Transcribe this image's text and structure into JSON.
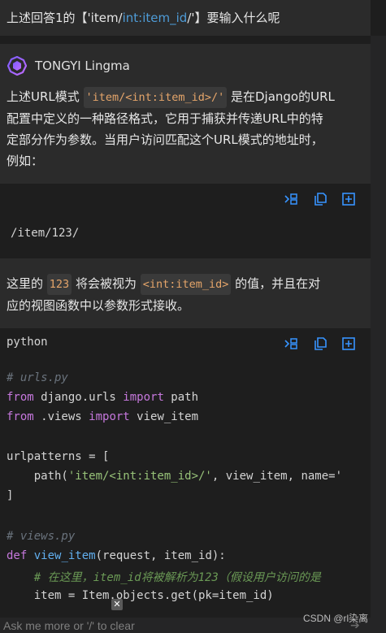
{
  "user_message": {
    "prefix": "上述回答1的【'item/",
    "highlight": "int:item_id",
    "suffix": "/'】要输入什么呢"
  },
  "assistant": {
    "name": "TONGYI Lingma",
    "para1": {
      "line1_pre": "上述URL模式 ",
      "line1_code": "'item/<int:item_id>/'",
      "line1_post": " 是在Django的URL",
      "line2": "配置中定义的一种路径格式，它用于捕获并传递URL中的特",
      "line3": "定部分作为参数。当用户访问匹配这个URL模式的地址时，",
      "line4": "例如："
    },
    "example_path": "/item/123/",
    "para2": {
      "l1_pre": "这里的 ",
      "l1_code1": "123",
      "l1_mid": " 将会被视为 ",
      "l1_code2": "<int:item_id>",
      "l1_post": " 的值，并且在对",
      "line2": "应的视图函数中以参数形式接收。"
    },
    "code_block": {
      "language": "python",
      "lines": {
        "c1": "# urls.py",
        "l2_kw1": "from",
        "l2_mod": " django.urls ",
        "l2_kw2": "import",
        "l2_name": " path",
        "l3_kw1": "from",
        "l3_mod": " .views ",
        "l3_kw2": "import",
        "l3_name": " view_item",
        "l5": "urlpatterns = [",
        "l6_pre": "    path(",
        "l6_str": "'item/<int:item_id>/'",
        "l6_post": ", view_item, name='",
        "l7": "]",
        "c9": "# views.py",
        "l10_kw": "def",
        "l10_fn": " view_item",
        "l10_post": "(request, item_id):",
        "l11": "    # 在这里，item_id将被解析为123（假设用户访问的是",
        "l12": "    item = Item.objects.get(pk=item_id)"
      }
    }
  },
  "toolbar": {
    "insert_label": "insert",
    "copy_label": "copy",
    "new_file_label": "new file"
  },
  "input": {
    "placeholder": "Ask me more or '/' to clear"
  },
  "watermark": "CSDN @rl染离",
  "icons": {
    "insert": "insert-code-icon",
    "copy": "copy-icon",
    "new_file": "new-file-icon",
    "close": "close-icon",
    "send": "send-icon",
    "logo": "tongyi-logo-icon"
  },
  "colors": {
    "accent": "#4e9bd6",
    "background": "#1e1e1e",
    "card": "#2b2b2b",
    "keyword": "#c678dd",
    "string": "#98c379",
    "function": "#61afef",
    "inline_code": "#e5a56a"
  }
}
